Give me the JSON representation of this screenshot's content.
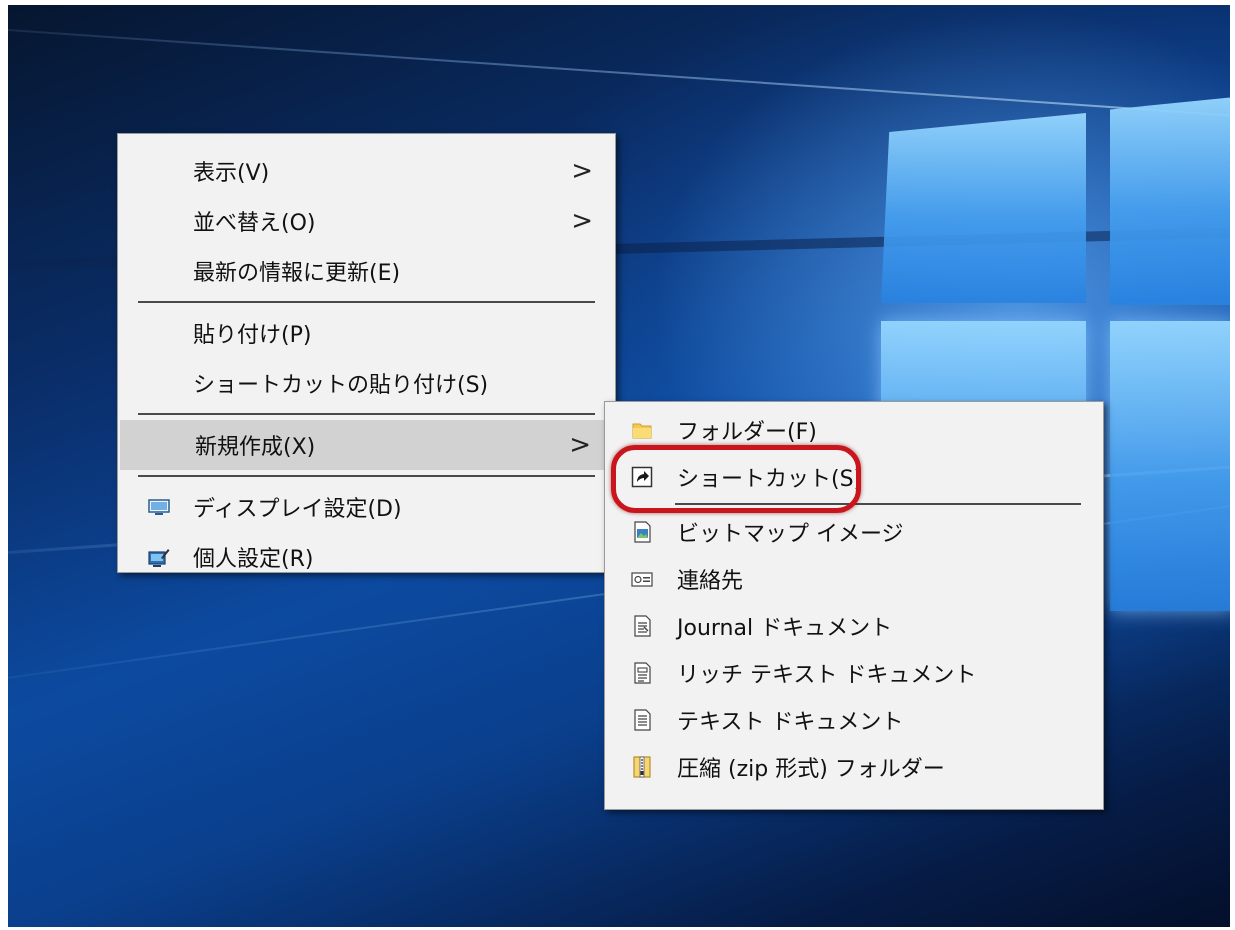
{
  "desktop": {
    "logo": "windows-10-logo"
  },
  "main_menu": {
    "items": [
      {
        "label": "表示(V)",
        "has_submenu": true
      },
      {
        "label": "並べ替え(O)",
        "has_submenu": true
      },
      {
        "label": "最新の情報に更新(E)"
      },
      {
        "label": "貼り付け(P)"
      },
      {
        "label": "ショートカットの貼り付け(S)"
      },
      {
        "label": "新規作成(X)",
        "has_submenu": true,
        "highlighted": true
      },
      {
        "label": "ディスプレイ設定(D)",
        "icon": "display-icon"
      },
      {
        "label": "個人設定(R)",
        "icon": "personalize-icon"
      }
    ],
    "arrow_glyph": ">"
  },
  "sub_menu": {
    "items": [
      {
        "label": "フォルダー(F)",
        "icon": "folder-icon"
      },
      {
        "label": "ショートカット(S)",
        "icon": "shortcut-icon",
        "circled": true
      },
      {
        "label": "ビットマップ イメージ",
        "icon": "bitmap-icon"
      },
      {
        "label": "連絡先",
        "icon": "contact-icon"
      },
      {
        "label": "Journal ドキュメント",
        "icon": "journal-icon"
      },
      {
        "label": "リッチ テキスト ドキュメント",
        "icon": "rich-text-icon"
      },
      {
        "label": "テキスト ドキュメント",
        "icon": "text-document-icon"
      },
      {
        "label": "圧縮 (zip 形式) フォルダー",
        "icon": "zip-folder-icon"
      }
    ]
  },
  "colors": {
    "highlight_ring": "#c8161c",
    "menu_background": "#f2f2f2",
    "hover_background": "#d2d2d2"
  }
}
